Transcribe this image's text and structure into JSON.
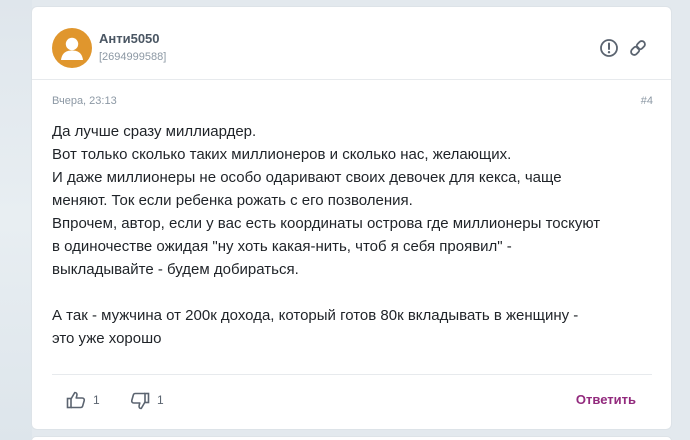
{
  "post": {
    "author": "Анти5050",
    "author_id": "[2694999588]",
    "date": "Вчера, 23:13",
    "number": "#4",
    "lines": [
      "Да лучше сразу миллиардер.",
      "Вот только сколько таких миллионеров и сколько нас, желающих.",
      "И даже миллионеры не особо одаривают своих девочек для кекса, чаще",
      "меняют. Ток если ребенка рожать с его позволения.",
      "Впрочем, автор, если у вас есть координаты острова где миллионеры тоскуют",
      "в одиночестве ожидая \"ну хоть какая-нить, чтоб я себя проявил\" -",
      "выкладывайте - будем добираться.",
      "",
      "А так - мужчина от 200к дохода, который готов 80к вкладывать в женщину -",
      "это уже хорошо"
    ],
    "likes": "1",
    "dislikes": "1",
    "reply_label": "Ответить"
  },
  "icons": {
    "avatar": "user-avatar-icon",
    "report": "report-icon",
    "link": "link-icon",
    "like": "thumbs-up-icon",
    "dislike": "thumbs-down-icon"
  },
  "colors": {
    "avatar_bg": "#e0962d",
    "reply": "#922a7d",
    "author": "#4a5663",
    "meta": "#8c98a4"
  }
}
